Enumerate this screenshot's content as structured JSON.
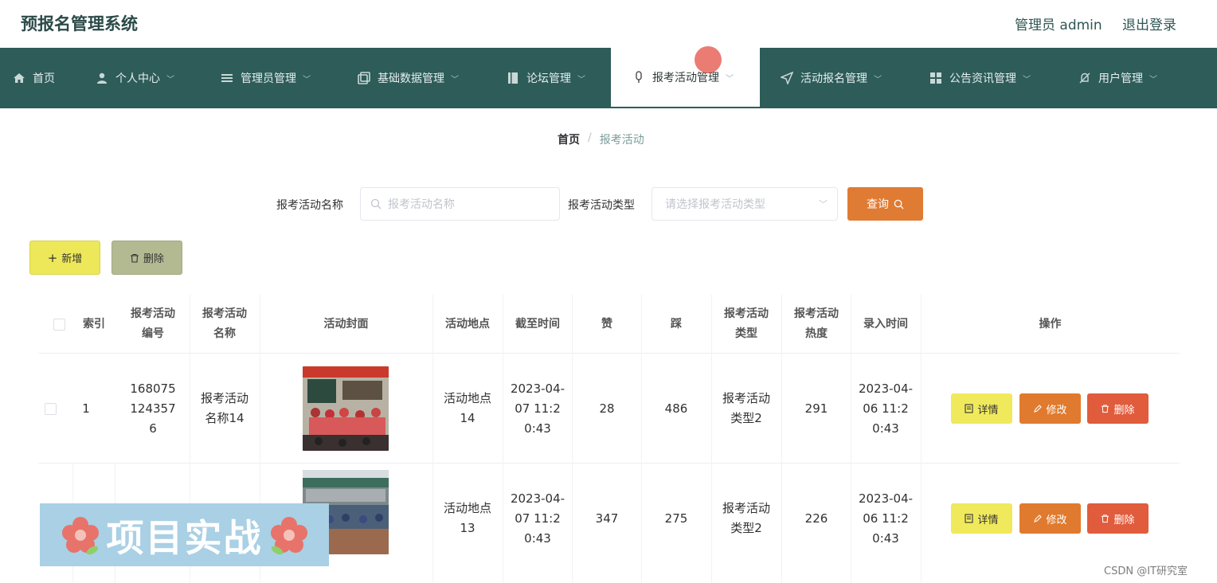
{
  "header": {
    "title": "预报名管理系统",
    "admin_label": "管理员 admin",
    "logout": "退出登录"
  },
  "nav": {
    "items": [
      {
        "label": "首页",
        "icon": "home-icon"
      },
      {
        "label": "个人中心",
        "icon": "user-icon"
      },
      {
        "label": "管理员管理",
        "icon": "list-icon"
      },
      {
        "label": "基础数据管理",
        "icon": "copy-icon"
      },
      {
        "label": "论坛管理",
        "icon": "notebook-icon"
      },
      {
        "label": "报考活动管理",
        "icon": "microphone-icon",
        "active": true
      },
      {
        "label": "活动报名管理",
        "icon": "send-icon"
      },
      {
        "label": "公告资讯管理",
        "icon": "grid-icon"
      },
      {
        "label": "用户管理",
        "icon": "no-bell-icon"
      }
    ]
  },
  "breadcrumb": {
    "home": "首页",
    "separator": "/",
    "current": "报考活动"
  },
  "search": {
    "name_label": "报考活动名称",
    "name_placeholder": "报考活动名称",
    "type_label": "报考活动类型",
    "type_placeholder": "请选择报考活动类型",
    "query_button": "查询"
  },
  "toolbar": {
    "add_label": "新增",
    "delete_label": "删除"
  },
  "table": {
    "headers": {
      "index": "索引",
      "code": "报考活动编号",
      "name": "报考活动名称",
      "cover": "活动封面",
      "location": "活动地点",
      "deadline": "截至时间",
      "likes": "赞",
      "dislikes": "踩",
      "type": "报考活动类型",
      "heat": "报考活动热度",
      "created": "录入时间",
      "actions": "操作"
    },
    "rows": [
      {
        "index": "1",
        "code": "1680751243576",
        "name": "报考活动名称14",
        "location": "活动地点14",
        "deadline": "2023-04-07 11:20:43",
        "likes": "28",
        "dislikes": "486",
        "type": "报考活动类型2",
        "heat": "291",
        "created": "2023-04-06 11:20:43"
      },
      {
        "index": "",
        "code": "",
        "name": "",
        "location": "活动地点13",
        "deadline": "2023-04-07 11:20:43",
        "likes": "347",
        "dislikes": "275",
        "type": "报考活动类型2",
        "heat": "226",
        "created": "2023-04-06 11:20:43"
      }
    ],
    "action_labels": {
      "detail": "详情",
      "edit": "修改",
      "delete": "删除"
    }
  },
  "overlay": {
    "banner_text": "项目实战",
    "watermark": "CSDN @IT研究室"
  },
  "colors": {
    "nav_bg": "#2d5c59",
    "query_btn": "#e07b33",
    "add_btn": "#ede85a",
    "bulk_delete_btn": "#b3ba92",
    "detail_btn": "#f0e95c",
    "edit_btn": "#e07a2e",
    "delete_btn": "#e05c3c",
    "banner_bg": "#a9d0e4"
  }
}
